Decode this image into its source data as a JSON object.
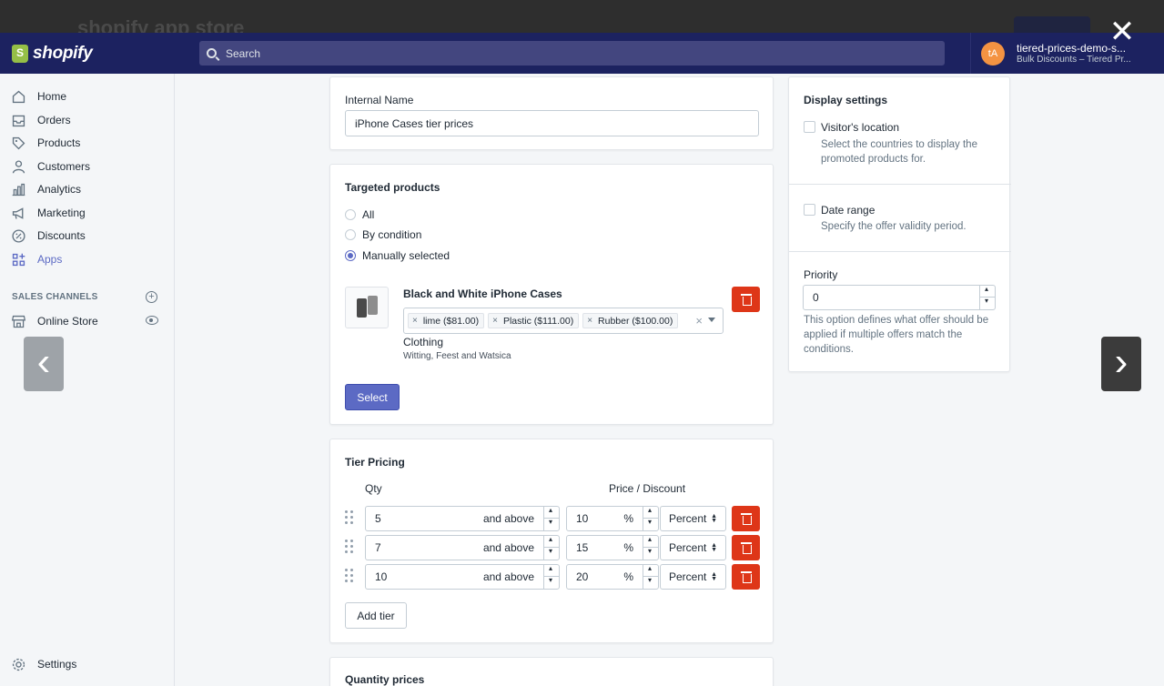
{
  "behind": {
    "faint_text": "shopify app store"
  },
  "topbar": {
    "brand": "shopify",
    "search_placeholder": "Search",
    "store_initials": "tA",
    "store_name": "tiered-prices-demo-s...",
    "store_sub": "Bulk Discounts – Tiered Pr..."
  },
  "close_label": "✕",
  "sidebar": {
    "items": [
      {
        "label": "Home",
        "icon": "home-icon"
      },
      {
        "label": "Orders",
        "icon": "orders-icon"
      },
      {
        "label": "Products",
        "icon": "tag-icon"
      },
      {
        "label": "Customers",
        "icon": "person-icon"
      },
      {
        "label": "Analytics",
        "icon": "analytics-icon"
      },
      {
        "label": "Marketing",
        "icon": "megaphone-icon"
      },
      {
        "label": "Discounts",
        "icon": "discount-icon"
      },
      {
        "label": "Apps",
        "icon": "apps-icon"
      }
    ],
    "sales_channels_heading": "SALES CHANNELS",
    "online_store": "Online Store",
    "settings": "Settings"
  },
  "internal_name": {
    "label": "Internal Name",
    "value": "iPhone Cases tier prices"
  },
  "targeted": {
    "heading": "Targeted products",
    "options": [
      "All",
      "By condition",
      "Manually selected"
    ],
    "selected": "Manually selected",
    "product": {
      "title": "Black and White iPhone Cases",
      "variants": [
        "lime ($81.00)",
        "Plastic ($111.00)",
        "Rubber ($100.00)"
      ],
      "type": "Clothing",
      "vendor": "Witting, Feest and Watsica"
    },
    "select_button": "Select"
  },
  "tier": {
    "heading": "Tier Pricing",
    "col_qty": "Qty",
    "col_price": "Price / Discount",
    "suffix": "and above",
    "pct": "%",
    "rows": [
      {
        "qty": "5",
        "discount": "10",
        "type": "Percent"
      },
      {
        "qty": "7",
        "discount": "15",
        "type": "Percent"
      },
      {
        "qty": "10",
        "discount": "20",
        "type": "Percent"
      }
    ],
    "add_button": "Add tier"
  },
  "quantity_prices": {
    "heading": "Quantity prices"
  },
  "display": {
    "heading": "Display settings",
    "visitor_label": "Visitor's location",
    "visitor_help": "Select the countries to display the promoted products for.",
    "date_label": "Date range",
    "date_help": "Specify the offer validity period.",
    "priority_label": "Priority",
    "priority_value": "0",
    "priority_help": "This option defines what offer should be applied if multiple offers match the conditions."
  },
  "colors": {
    "accent": "#5c6ac4",
    "danger": "#de3618",
    "topbar": "#1c2260"
  }
}
